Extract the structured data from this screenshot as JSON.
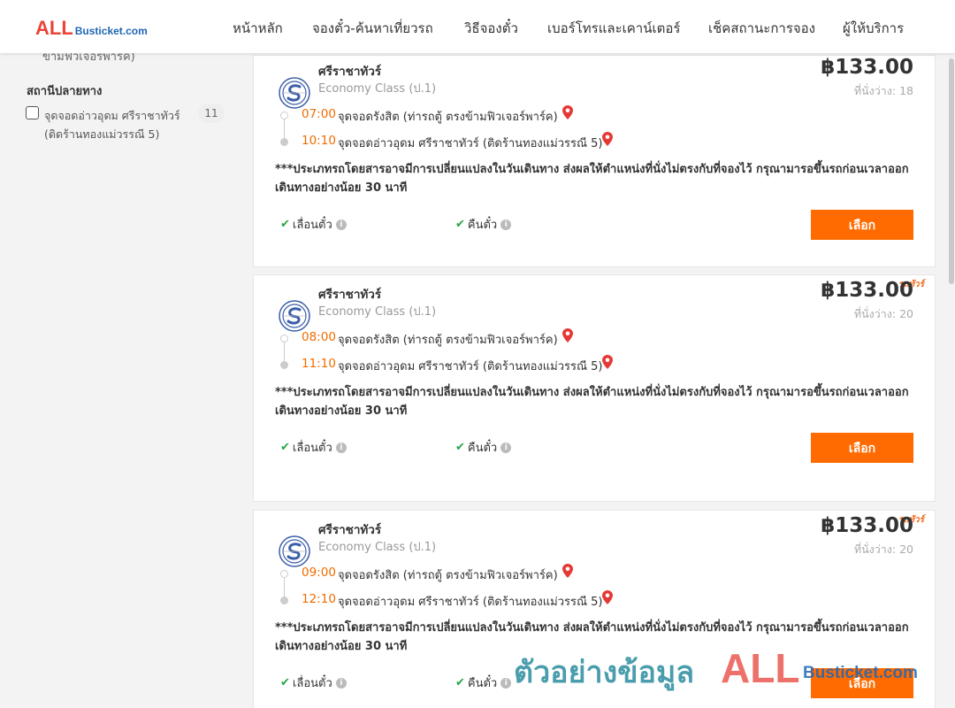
{
  "header": {
    "logo_main": "ALL",
    "logo_sub": "Busticket.com",
    "nav": [
      {
        "label": "หน้าหลัก"
      },
      {
        "label": "จองตั๋ว-ค้นหาเที่ยวรถ"
      },
      {
        "label": "วิธีจองตั๋ว"
      },
      {
        "label": "เบอร์โทรและเคาน์เตอร์"
      },
      {
        "label": "เช็คสถานะการจอง"
      },
      {
        "label": "ผู้ให้บริการ"
      }
    ]
  },
  "sidebar": {
    "cut_text": "ข้ามฟิวเจอร์พาร์ค)",
    "destination_heading": "สถานีปลายทาง",
    "destination_option": {
      "label_line1": "จุดจอดอ่าวอุดม ศรีราชาทัวร์",
      "label_line2": "(ติดร้านทองแม่วรรณี 5)",
      "count": "11",
      "checked": false
    }
  },
  "trips": [
    {
      "tag": "",
      "operator": "ศรีราชาทัวร์",
      "bus_class": "Economy Class (ป.1)",
      "price": "฿133.00",
      "seats": "ที่นั่งว่าง: 18",
      "depart_time": "07:00",
      "depart_stop": "จุดจอดรังสิต (ท่ารถตู้ ตรงข้ามฟิวเจอร์พาร์ค)",
      "arrive_time": "10:10",
      "arrive_stop": "จุดจอดอ่าวอุดม ศรีราชาทัวร์ (ติดร้านทองแม่วรรณี 5)",
      "note": "***ประเภทรถโดยสารอาจมีการเปลี่ยนแปลงในวันเดินทาง ส่งผลให้ตำแหน่งที่นั่งไม่ตรงกับที่จองไว้ กรุณามารอขึ้นรถก่อนเวลาออกเดินทางอย่างน้อย 30 นาที",
      "feature_reschedule": "เลื่อนตั๋ว",
      "feature_refund": "คืนตั๋ว",
      "select_label": "เลือก"
    },
    {
      "tag": "รถทัวร์",
      "operator": "ศรีราชาทัวร์",
      "bus_class": "Economy Class (ป.1)",
      "price": "฿133.00",
      "seats": "ที่นั่งว่าง: 20",
      "depart_time": "08:00",
      "depart_stop": "จุดจอดรังสิต (ท่ารถตู้ ตรงข้ามฟิวเจอร์พาร์ค)",
      "arrive_time": "11:10",
      "arrive_stop": "จุดจอดอ่าวอุดม ศรีราชาทัวร์ (ติดร้านทองแม่วรรณี 5)",
      "note": "***ประเภทรถโดยสารอาจมีการเปลี่ยนแปลงในวันเดินทาง ส่งผลให้ตำแหน่งที่นั่งไม่ตรงกับที่จองไว้ กรุณามารอขึ้นรถก่อนเวลาออกเดินทางอย่างน้อย 30 นาที",
      "feature_reschedule": "เลื่อนตั๋ว",
      "feature_refund": "คืนตั๋ว",
      "select_label": "เลือก"
    },
    {
      "tag": "รถทัวร์",
      "operator": "ศรีราชาทัวร์",
      "bus_class": "Economy Class (ป.1)",
      "price": "฿133.00",
      "seats": "ที่นั่งว่าง: 20",
      "depart_time": "09:00",
      "depart_stop": "จุดจอดรังสิต (ท่ารถตู้ ตรงข้ามฟิวเจอร์พาร์ค)",
      "arrive_time": "12:10",
      "arrive_stop": "จุดจอดอ่าวอุดม ศรีราชาทัวร์ (ติดร้านทองแม่วรรณี 5)",
      "note": "***ประเภทรถโดยสารอาจมีการเปลี่ยนแปลงในวันเดินทาง ส่งผลให้ตำแหน่งที่นั่งไม่ตรงกับที่จองไว้ กรุณามารอขึ้นรถก่อนเวลาออกเดินทางอย่างน้อย 30 นาที",
      "feature_reschedule": "เลื่อนตั๋ว",
      "feature_refund": "คืนตั๋ว",
      "select_label": "เลือก"
    }
  ],
  "watermark": {
    "text": "ตัวอย่างข้อมูล",
    "brand_main": "ALL",
    "brand_sub": "Busticket.com"
  },
  "colors": {
    "accent": "#ff6b00",
    "time": "#ef6c00",
    "check": "#27a544",
    "pin": "#e53935"
  },
  "icons": {
    "operator_logo": "sriracha-tour-logo",
    "pin": "map-pin-icon",
    "check": "check-icon",
    "info": "info-icon"
  }
}
